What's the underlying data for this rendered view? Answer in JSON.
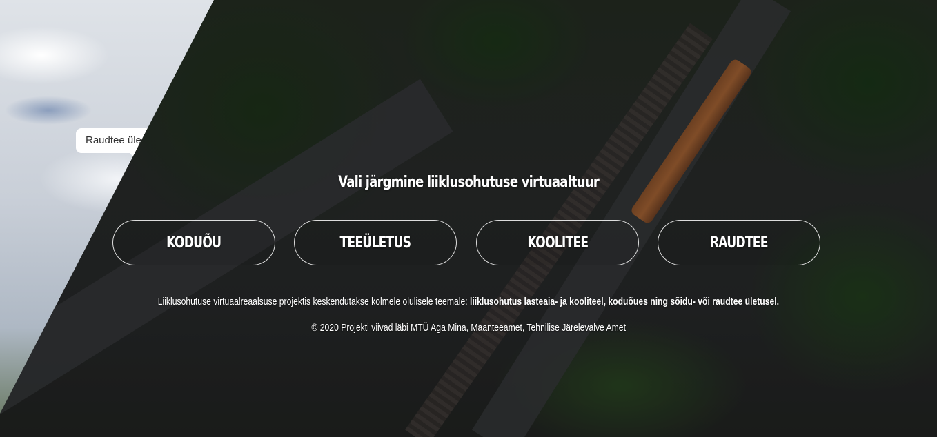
{
  "tooltip": {
    "label": "Raudtee üle"
  },
  "heading": "Vali järgmine liiklusohutuse virtuaaltuur",
  "tours": [
    {
      "label": "KODUÕU"
    },
    {
      "label": "TEEÜLETUS"
    },
    {
      "label": "KOOLITEE"
    },
    {
      "label": "RAUDTEE"
    }
  ],
  "description": {
    "intro": "Liiklusohutuse virtuaalreaalsuse projektis keskendutakse kolmele olulisele teemale: ",
    "topics": "liiklusohutus lasteaia- ja kooliteel, koduõues ning sõidu- või raudtee ületusel."
  },
  "copyright": "© 2020 Projekti viivad läbi MTÜ Aga Mina, Maanteeamet, Tehnilise Järelevalve Amet"
}
